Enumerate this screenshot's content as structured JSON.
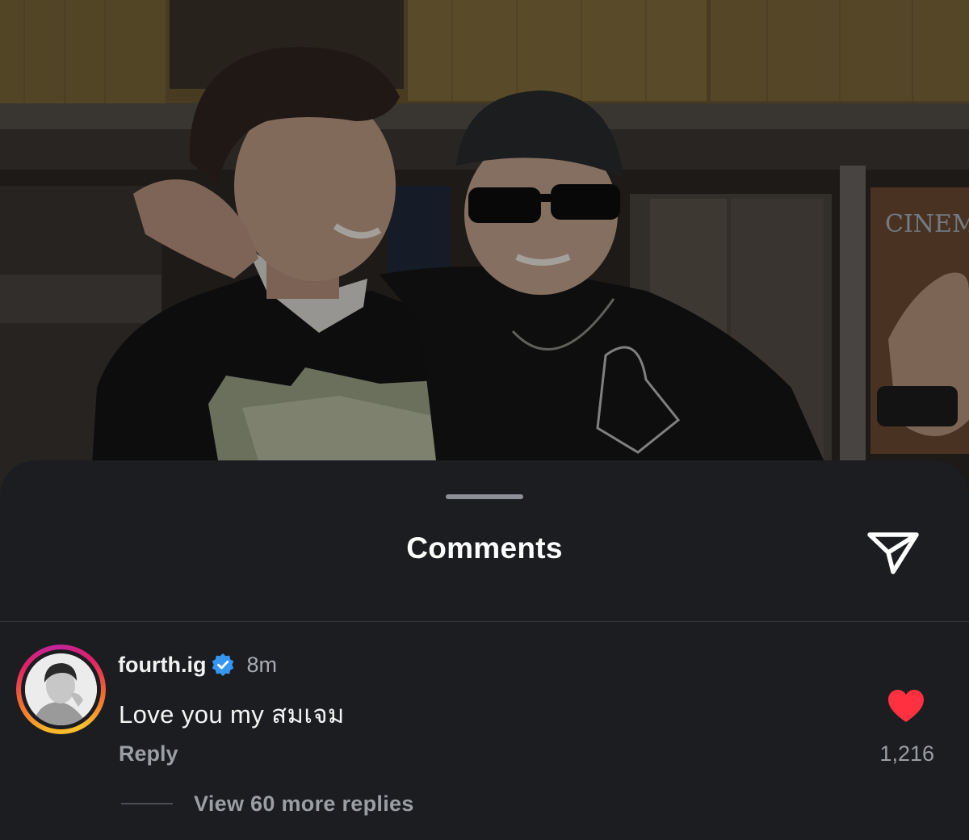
{
  "background_photo": {
    "signage_text": "CINEM"
  },
  "comments_sheet": {
    "title": "Comments"
  },
  "comment": {
    "username": "fourth.ig",
    "verified": true,
    "time_ago": "8m",
    "text": "Love you my สมเจม",
    "reply_label": "Reply",
    "liked": true,
    "like_count": "1,216",
    "view_replies_label": "View 60 more replies"
  },
  "icons": {
    "share": "paper-plane-icon",
    "like": "heart-filled-icon",
    "verified": "verified-badge-icon"
  },
  "colors": {
    "sheet_background": "#1b1d21",
    "like_red": "#ff3040",
    "verified_blue": "#3797f0",
    "secondary_text": "#9b9ea3"
  }
}
